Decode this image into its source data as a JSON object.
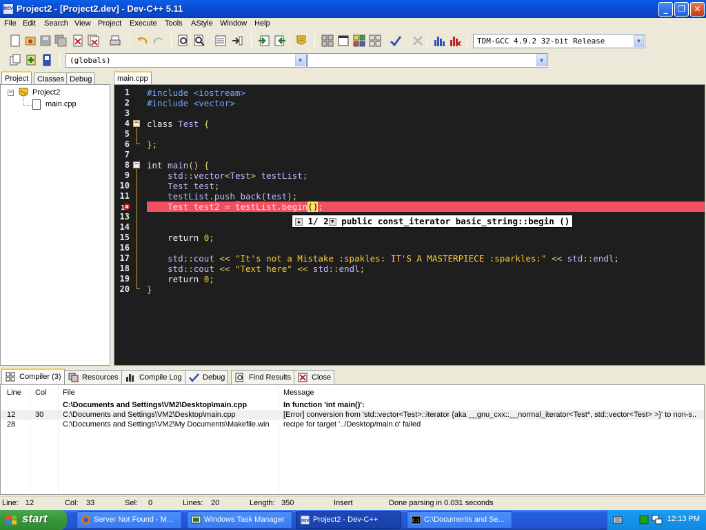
{
  "window": {
    "title": "Project2 - [Project2.dev] - Dev-C++ 5.11",
    "app_icon_text": "DEV"
  },
  "menu": [
    "File",
    "Edit",
    "Search",
    "View",
    "Project",
    "Execute",
    "Tools",
    "AStyle",
    "Window",
    "Help"
  ],
  "toolbar": {
    "compiler_select": "TDM-GCC 4.9.2 32-bit Release",
    "scope_select": "(globals)",
    "function_select": ""
  },
  "left_panel": {
    "tabs": [
      "Project",
      "Classes",
      "Debug"
    ],
    "active_tab": "Project",
    "tree": {
      "project": "Project2",
      "files": [
        "main.cpp"
      ]
    }
  },
  "editor": {
    "tab": "main.cpp",
    "error_line": 12,
    "hint": {
      "counter": "1/ 2",
      "text": "public const_iterator basic_string::begin ()"
    }
  },
  "bottom_panel": {
    "tabs": [
      {
        "label": "Compiler (3)",
        "icon": "grid-icon"
      },
      {
        "label": "Resources",
        "icon": "resources-icon"
      },
      {
        "label": "Compile Log",
        "icon": "chart-icon"
      },
      {
        "label": "Debug",
        "icon": "check-icon"
      },
      {
        "label": "Find Results",
        "icon": "find-icon"
      },
      {
        "label": "Close",
        "icon": "close-icon"
      }
    ],
    "columns": [
      "Line",
      "Col",
      "File",
      "Message"
    ],
    "rows": [
      {
        "line": "",
        "col": "",
        "file": "C:\\Documents and Settings\\VM2\\Desktop\\main.cpp",
        "message": "In function 'int main()':",
        "bold": true
      },
      {
        "line": "12",
        "col": "30",
        "file": "C:\\Documents and Settings\\VM2\\Desktop\\main.cpp",
        "message": "[Error] conversion from 'std::vector<Test>::iterator {aka __gnu_cxx::__normal_iterator<Test*, std::vector<Test> >}' to non-s...",
        "bold": false
      },
      {
        "line": "28",
        "col": "",
        "file": "C:\\Documents and Settings\\VM2\\My Documents\\Makefile.win",
        "message": "recipe for target '../Desktop/main.o' failed",
        "bold": false
      }
    ]
  },
  "status": {
    "line_label": "Line:",
    "line": "12",
    "col_label": "Col:",
    "col": "33",
    "sel_label": "Sel:",
    "sel": "0",
    "lines_label": "Lines:",
    "lines": "20",
    "length_label": "Length:",
    "length": "350",
    "mode": "Insert",
    "message": "Done parsing in 0.031 seconds"
  },
  "taskbar": {
    "start": "start",
    "tasks": [
      {
        "label": "Server Not Found - M...",
        "active": false
      },
      {
        "label": "Windows Task Manager",
        "active": false
      },
      {
        "label": "Project2 - Dev-C++",
        "active": true
      },
      {
        "label": "C:\\Documents and Se...",
        "active": false
      }
    ],
    "clock": "12:13 PM"
  },
  "colors": {
    "editor_bg": "#1e1e1e",
    "error_line": "#f05060",
    "titlebar": "#0a4fd6"
  }
}
